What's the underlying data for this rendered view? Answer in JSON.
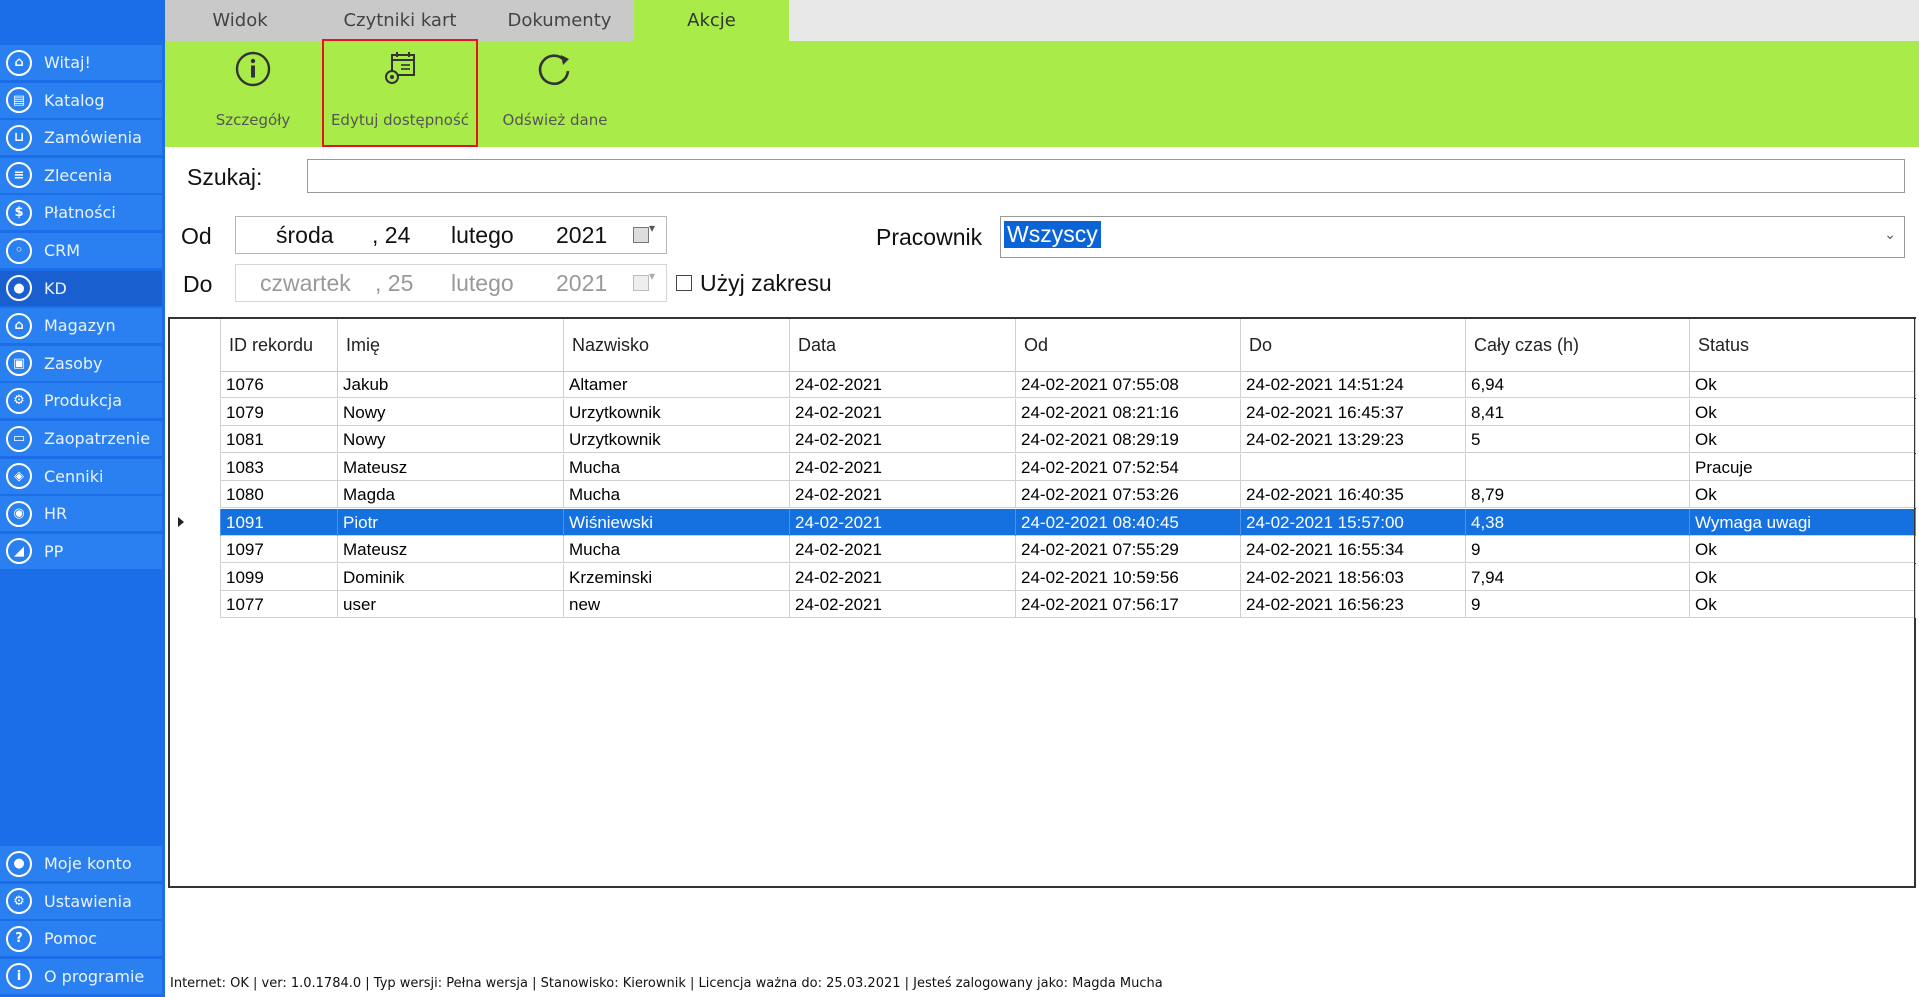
{
  "tabs": [
    "Widok",
    "Czytniki kart",
    "Dokumenty",
    "Akcje"
  ],
  "active_tab": "Akcje",
  "ribbon": {
    "details": "Szczegóły",
    "edit_availability": "Edytuj dostępność",
    "refresh": "Odśwież dane"
  },
  "sidebar": {
    "items": [
      {
        "label": "Witaj!",
        "icon": "home-icon"
      },
      {
        "label": "Katalog",
        "icon": "book-icon"
      },
      {
        "label": "Zamówienia",
        "icon": "cart-icon"
      },
      {
        "label": "Zlecenia",
        "icon": "list-icon"
      },
      {
        "label": "Płatności",
        "icon": "dollar-icon"
      },
      {
        "label": "CRM",
        "icon": "crm-icon"
      },
      {
        "label": "KD",
        "icon": "person-icon"
      },
      {
        "label": "Magazyn",
        "icon": "warehouse-icon"
      },
      {
        "label": "Zasoby",
        "icon": "resources-icon"
      },
      {
        "label": "Produkcja",
        "icon": "production-icon"
      },
      {
        "label": "Zaopatrzenie",
        "icon": "truck-icon"
      },
      {
        "label": "Cenniki",
        "icon": "tag-icon"
      },
      {
        "label": "HR",
        "icon": "hr-icon"
      },
      {
        "label": "PP",
        "icon": "chart-icon"
      }
    ],
    "bottom": [
      {
        "label": "Moje konto",
        "icon": "account-icon"
      },
      {
        "label": "Ustawienia",
        "icon": "gear-icon"
      },
      {
        "label": "Pomoc",
        "icon": "help-icon"
      },
      {
        "label": "O programie",
        "icon": "info-icon"
      }
    ],
    "active": "KD"
  },
  "search": {
    "label": "Szukaj:",
    "value": ""
  },
  "from": {
    "label": "Od",
    "weekday": "środa",
    "day": ", 24",
    "month": "lutego",
    "year": "2021"
  },
  "to": {
    "label": "Do",
    "weekday": "czwartek",
    "day": ", 25",
    "month": "lutego",
    "year": "2021"
  },
  "use_range": {
    "label": "Użyj zakresu",
    "checked": false
  },
  "employee": {
    "label": "Pracownik",
    "value": "Wszyscy"
  },
  "table": {
    "columns": [
      "ID rekordu",
      "Imię",
      "Nazwisko",
      "Data",
      "Od",
      "Do",
      "Cały czas (h)",
      "Status"
    ],
    "rows": [
      [
        "1076",
        "Jakub",
        "Altamer",
        "24-02-2021",
        "24-02-2021 07:55:08",
        "24-02-2021 14:51:24",
        "6,94",
        "Ok"
      ],
      [
        "1079",
        "Nowy",
        "Urzytkownik",
        "24-02-2021",
        "24-02-2021 08:21:16",
        "24-02-2021 16:45:37",
        "8,41",
        "Ok"
      ],
      [
        "1081",
        "Nowy",
        "Urzytkownik",
        "24-02-2021",
        "24-02-2021 08:29:19",
        "24-02-2021 13:29:23",
        "5",
        "Ok"
      ],
      [
        "1083",
        "Mateusz",
        "Mucha",
        "24-02-2021",
        "24-02-2021 07:52:54",
        "",
        "",
        "Pracuje"
      ],
      [
        "1080",
        "Magda",
        "Mucha",
        "24-02-2021",
        "24-02-2021 07:53:26",
        "24-02-2021 16:40:35",
        "8,79",
        "Ok"
      ],
      [
        "1091",
        "Piotr",
        "Wiśniewski",
        "24-02-2021",
        "24-02-2021 08:40:45",
        "24-02-2021 15:57:00",
        "4,38",
        "Wymaga uwagi"
      ],
      [
        "1097",
        "Mateusz",
        "Mucha",
        "24-02-2021",
        "24-02-2021 07:55:29",
        "24-02-2021 16:55:34",
        "9",
        "Ok"
      ],
      [
        "1099",
        "Dominik",
        "Krzeminski",
        "24-02-2021",
        "24-02-2021 10:59:56",
        "24-02-2021 18:56:03",
        "7,94",
        "Ok"
      ],
      [
        "1077",
        "user",
        "new",
        "24-02-2021",
        "24-02-2021 07:56:17",
        "24-02-2021 16:56:23",
        "9",
        "Ok"
      ]
    ],
    "selected_index": 5
  },
  "statusbar": "Internet: OK  |  ver: 1.0.1784.0  |  Typ wersji: Pełna wersja  |  Stanowisko: Kierownik  |  Licencja ważna do: 25.03.2021  |  Jesteś zalogowany jako: Magda Mucha",
  "colors": {
    "accent_green": "#a9ec4a",
    "sidebar_blue": "#1b6de8",
    "selection_blue": "#1570e0",
    "highlight_red": "#e8121f"
  }
}
